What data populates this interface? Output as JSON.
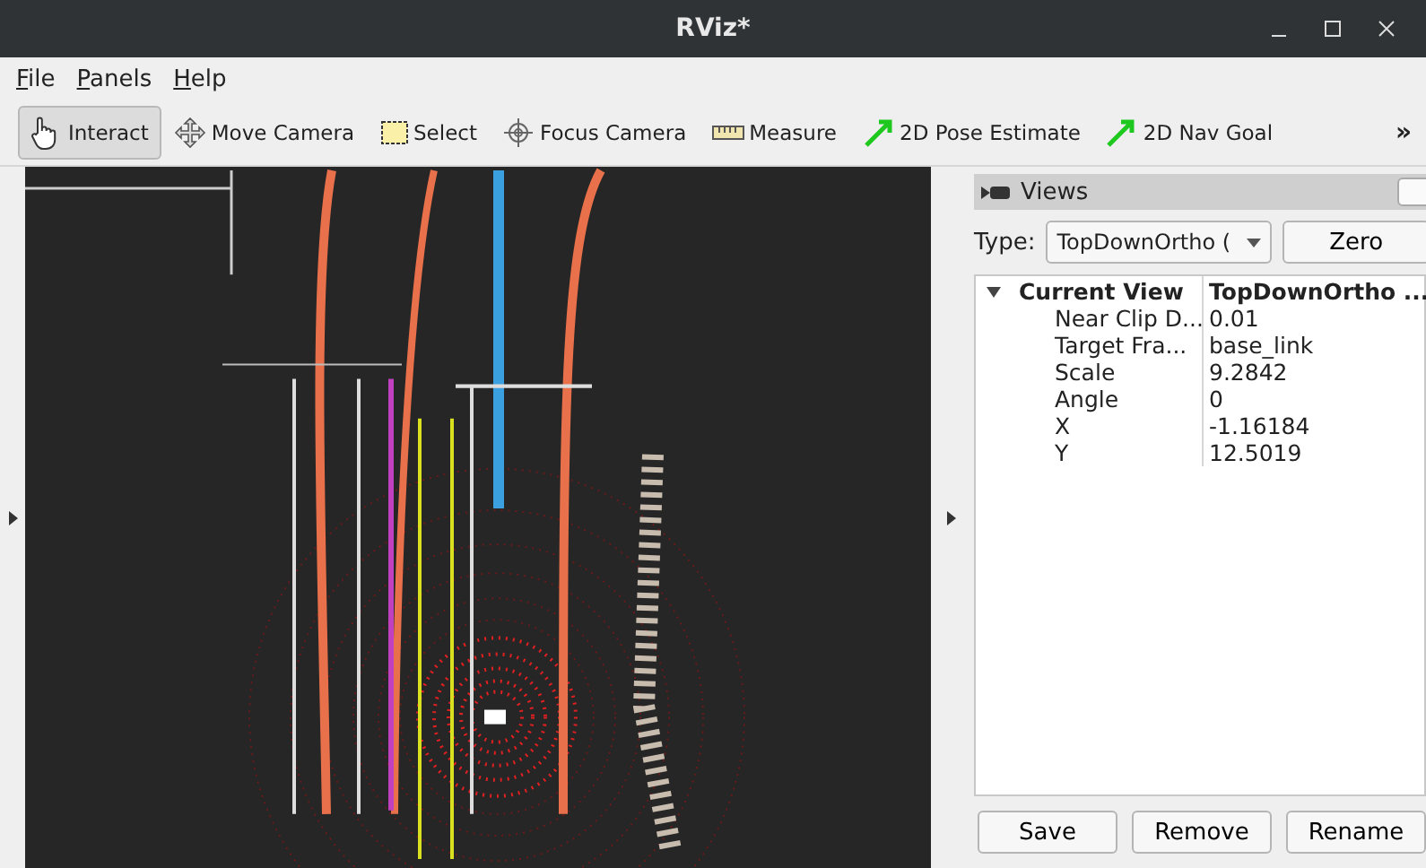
{
  "window": {
    "title": "RViz*"
  },
  "menu": [
    "File",
    "Panels",
    "Help"
  ],
  "tools": [
    {
      "label": "Interact",
      "kind": "hand",
      "selected": true
    },
    {
      "label": "Move Camera",
      "kind": "move",
      "selected": false
    },
    {
      "label": "Select",
      "kind": "select",
      "selected": false
    },
    {
      "label": "Focus Camera",
      "kind": "focus",
      "selected": false
    },
    {
      "label": "Measure",
      "kind": "ruler",
      "selected": false
    },
    {
      "label": "2D Pose Estimate",
      "kind": "arrow",
      "selected": false
    },
    {
      "label": "2D Nav Goal",
      "kind": "arrow",
      "selected": false
    }
  ],
  "toolbar_overflow": "»",
  "views_panel": {
    "title": "Views",
    "type_label": "Type:",
    "type_value": "TopDownOrtho (",
    "zero_button": "Zero",
    "tree": {
      "name": "Current View",
      "value": "TopDownOrtho ...",
      "expanded": true,
      "children": [
        {
          "name": "Near Clip D...",
          "value": "0.01"
        },
        {
          "name": "Target Fra...",
          "value": "base_link"
        },
        {
          "name": "Scale",
          "value": "9.2842"
        },
        {
          "name": "Angle",
          "value": "0"
        },
        {
          "name": "X",
          "value": "-1.16184"
        },
        {
          "name": "Y",
          "value": "12.5019"
        }
      ]
    },
    "buttons": [
      "Save",
      "Remove",
      "Rename"
    ]
  }
}
